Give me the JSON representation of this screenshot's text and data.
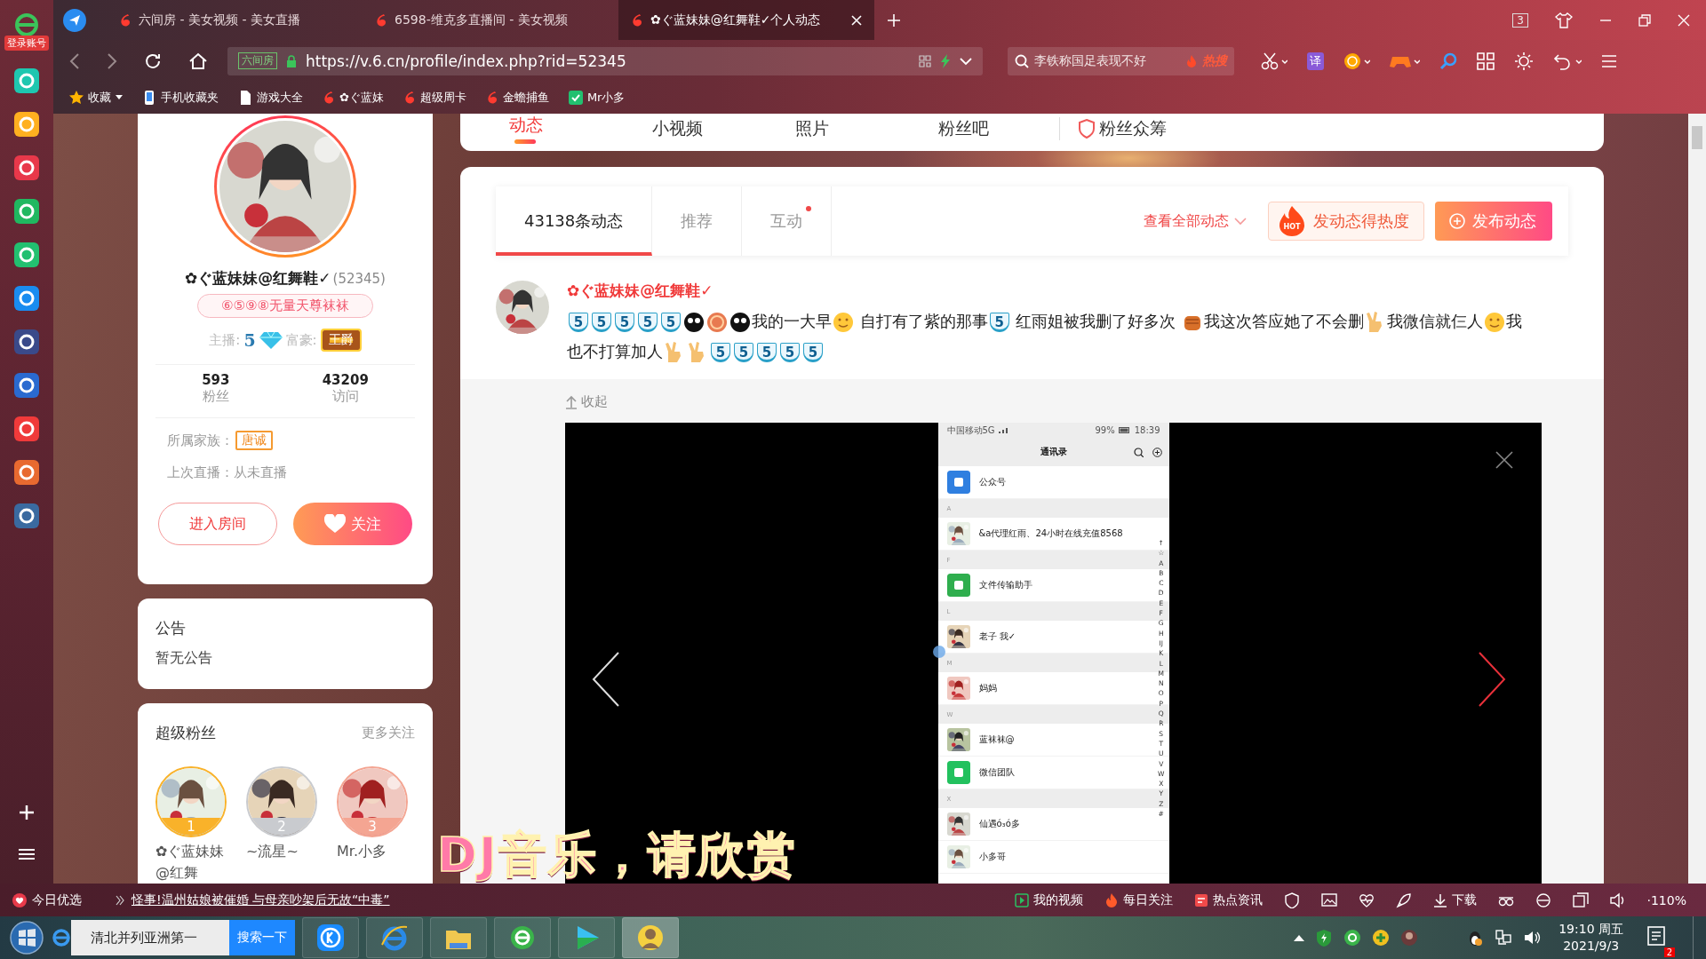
{
  "app_sidebar": {
    "login_badge": "登录账号"
  },
  "browser": {
    "tabs": [
      {
        "title": "六间房 - 美女视频 - 美女直播",
        "selected": false
      },
      {
        "title": "6598-维克多直播间 - 美女视频",
        "selected": false
      },
      {
        "title": "✿ぐ蓝妹妹@红舞鞋✓个人动态",
        "selected": true
      }
    ],
    "tab_count": "3",
    "address": {
      "site_badge": "六间房",
      "url": "https://v.6.cn/profile/index.php?rid=52345"
    },
    "search": {
      "value": "李铁称国足表现不好",
      "hot_tag": "热搜"
    },
    "translate": "译",
    "bookmarks": [
      {
        "kind": "star",
        "label": "收藏"
      },
      {
        "kind": "phone",
        "label": "手机收藏夹"
      },
      {
        "kind": "page",
        "label": "游戏大全"
      },
      {
        "kind": "site",
        "label": "✿ぐ蓝妹"
      },
      {
        "kind": "site",
        "label": "超级周卡"
      },
      {
        "kind": "site",
        "label": "金蟾捕鱼"
      },
      {
        "kind": "app",
        "label": "Mr小多"
      }
    ]
  },
  "profile": {
    "name": "✿ぐ蓝妹妹@红舞鞋✓",
    "rid": "(52345)",
    "signature": "⑥⑤⑨⑧无量天尊袜袜",
    "anchor_label": "主播:",
    "anchor_level": "5",
    "rich_label": "富豪:",
    "rich_badge": "王爵",
    "stats": [
      {
        "value": "593",
        "label": "粉丝"
      },
      {
        "value": "43209",
        "label": "访问"
      }
    ],
    "family_label": "所属家族：",
    "family": "唐诚",
    "last_live": "上次直播：从未直播",
    "enter_button": "进入房间",
    "follow_button": "关注"
  },
  "announcement": {
    "title": "公告",
    "text": "暂无公告"
  },
  "super_fans": {
    "title": "超级粉丝",
    "more": "更多关注",
    "fans": [
      {
        "rank": "1",
        "name": "✿ぐ蓝妹妹@红舞",
        "color": "#f9b22a"
      },
      {
        "rank": "2",
        "name": "~流星~",
        "color": "#c9cbcf"
      },
      {
        "rank": "3",
        "name": "Mr.小多",
        "color": "#f4a592"
      }
    ]
  },
  "nav": {
    "tabs": [
      {
        "label": "动态",
        "selected": true,
        "kind": "plain"
      },
      {
        "label": "小视频",
        "selected": false,
        "kind": "plain"
      },
      {
        "label": "照片",
        "selected": false,
        "kind": "plain"
      },
      {
        "label": "粉丝吧",
        "selected": false,
        "kind": "plain"
      },
      {
        "label": "粉丝众筹",
        "selected": false,
        "kind": "crowdfund"
      }
    ]
  },
  "feed": {
    "tabs": [
      {
        "label": "43138条动态",
        "selected": true,
        "unread": false
      },
      {
        "label": "推荐",
        "selected": false,
        "unread": false
      },
      {
        "label": "互动",
        "selected": false,
        "unread": true
      }
    ],
    "view_all": "查看全部动态",
    "heat_button": {
      "icon_text": "HOT",
      "label": "发动态得热度"
    },
    "publish_button": "发布动态"
  },
  "post": {
    "author": "✿ぐ蓝妹妹@红舞鞋✓",
    "content": [
      {
        "kind": "badge",
        "text": "5"
      },
      {
        "kind": "badge",
        "text": "5"
      },
      {
        "kind": "badge",
        "text": "5"
      },
      {
        "kind": "badge",
        "text": "5"
      },
      {
        "kind": "badge",
        "text": "5"
      },
      {
        "kind": "dark-face"
      },
      {
        "kind": "coin"
      },
      {
        "kind": "dark-face"
      },
      {
        "kind": "text",
        "text": "我的一大早"
      },
      {
        "kind": "face"
      },
      {
        "kind": "text",
        "text": " 自打有了紫的那事"
      },
      {
        "kind": "badge",
        "text": "5"
      },
      {
        "kind": "text",
        "text": " 红雨姐被我删了好多次 "
      },
      {
        "kind": "fist"
      },
      {
        "kind": "text",
        "text": "我这次答应她了不会删"
      },
      {
        "kind": "hand"
      },
      {
        "kind": "text",
        "text": "我微信就仨人"
      },
      {
        "kind": "face"
      },
      {
        "kind": "text",
        "text": "我也不打算加人"
      },
      {
        "kind": "hand"
      },
      {
        "kind": "hand"
      },
      {
        "kind": "badge",
        "text": "5"
      },
      {
        "kind": "badge",
        "text": "5"
      },
      {
        "kind": "badge",
        "text": "5"
      },
      {
        "kind": "badge",
        "text": "5"
      },
      {
        "kind": "badge",
        "text": "5"
      }
    ],
    "collapse": "收起",
    "screenshot": {
      "carrier": "中国移动5G",
      "battery": "99%",
      "time": "18:39",
      "title": "通讯录",
      "rows": [
        {
          "kind": "service-contact",
          "name": "公众号",
          "color": "#2f7fe0"
        },
        {
          "kind": "section",
          "name": "A"
        },
        {
          "kind": "photo-contact",
          "name": "&a代理红雨、24小时在线充值8568"
        },
        {
          "kind": "section",
          "name": "F"
        },
        {
          "kind": "service-contact",
          "name": "文件传输助手",
          "color": "#2fae4e"
        },
        {
          "kind": "section",
          "name": "L"
        },
        {
          "kind": "photo-contact",
          "name": "老子 我✓"
        },
        {
          "kind": "section",
          "name": "M"
        },
        {
          "kind": "photo-contact",
          "name": "妈妈"
        },
        {
          "kind": "section",
          "name": "W"
        },
        {
          "kind": "photo-contact",
          "name": "蓝袜袜@"
        },
        {
          "kind": "service-contact",
          "name": "微信团队",
          "color": "#22c15e"
        },
        {
          "kind": "section",
          "name": "X"
        },
        {
          "kind": "photo-contact",
          "name": "仙遇ó₃ó多"
        },
        {
          "kind": "photo-contact",
          "name": "小多哥"
        }
      ],
      "index": "↑☆ABCDEFGHIJKLMNOPQRSTUVWXYZ#"
    }
  },
  "status_bar": {
    "today": "今日优选",
    "headline": "怪事!温州姑娘被催婚 与母亲吵架后无故“中毒”",
    "links": [
      "我的视频",
      "每日关注",
      "热点资讯"
    ],
    "download": "下载",
    "zoom": "·110%"
  },
  "taskbar": {
    "search_value": "清北并列亚洲第一",
    "search_button": "搜索一下",
    "time": "19:10 周五",
    "date": "2021/9/3",
    "notifications": "2"
  },
  "caption": "DJ音乐，请欣赏"
}
